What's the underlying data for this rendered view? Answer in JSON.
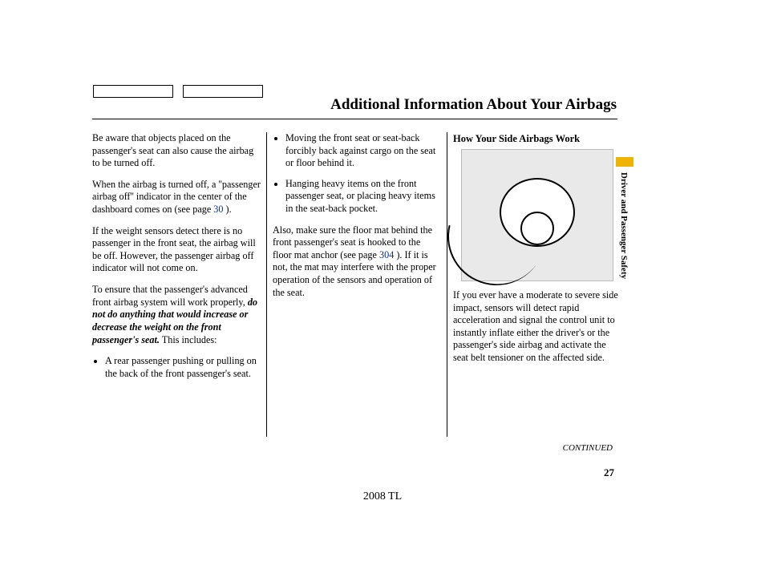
{
  "title": "Additional Information About Your Airbags",
  "tabCount": 2,
  "sideTabLabel": "Driver and Passenger Safety",
  "col1": {
    "p1": "Be aware that objects placed on the passenger's seat can also cause the airbag to be turned off.",
    "p2a": "When the airbag is turned off, a ''passenger airbag off'' indicator in the center of the dashboard comes on (see page ",
    "p2link": "30",
    "p2b": " ).",
    "p3": "If the weight sensors detect there is no passenger in the front seat, the airbag will be off. However, the passenger airbag off indicator will not come on.",
    "p4a": "To ensure that the passenger's advanced front airbag system will work properly, ",
    "p4b": "do not do anything that would increase or decrease the weight on the front passenger's seat.",
    "p4c": " This includes:",
    "li1": "A rear passenger pushing or pulling on the back of the front passenger's seat."
  },
  "col2": {
    "li1": "Moving the front seat or seat-back forcibly back against cargo on the seat or floor behind it.",
    "li2": "Hanging heavy items on the front passenger seat, or placing heavy items in the seat-back pocket.",
    "p1a": "Also, make sure the floor mat behind the front passenger's seat is hooked to the floor mat anchor (see page ",
    "p1link": "304",
    "p1b": " ). If it is not, the mat may interfere with the proper operation of the sensors and operation of the seat."
  },
  "col3": {
    "subhead": "How Your Side Airbags Work",
    "p1": "If you ever have a moderate to severe side impact, sensors will detect rapid acceleration and signal the control unit to instantly inflate either the driver's or the passenger's side airbag and activate the seat belt tensioner on the affected side."
  },
  "continued": "CONTINUED",
  "pageNumber": "27",
  "footer": "2008  TL"
}
